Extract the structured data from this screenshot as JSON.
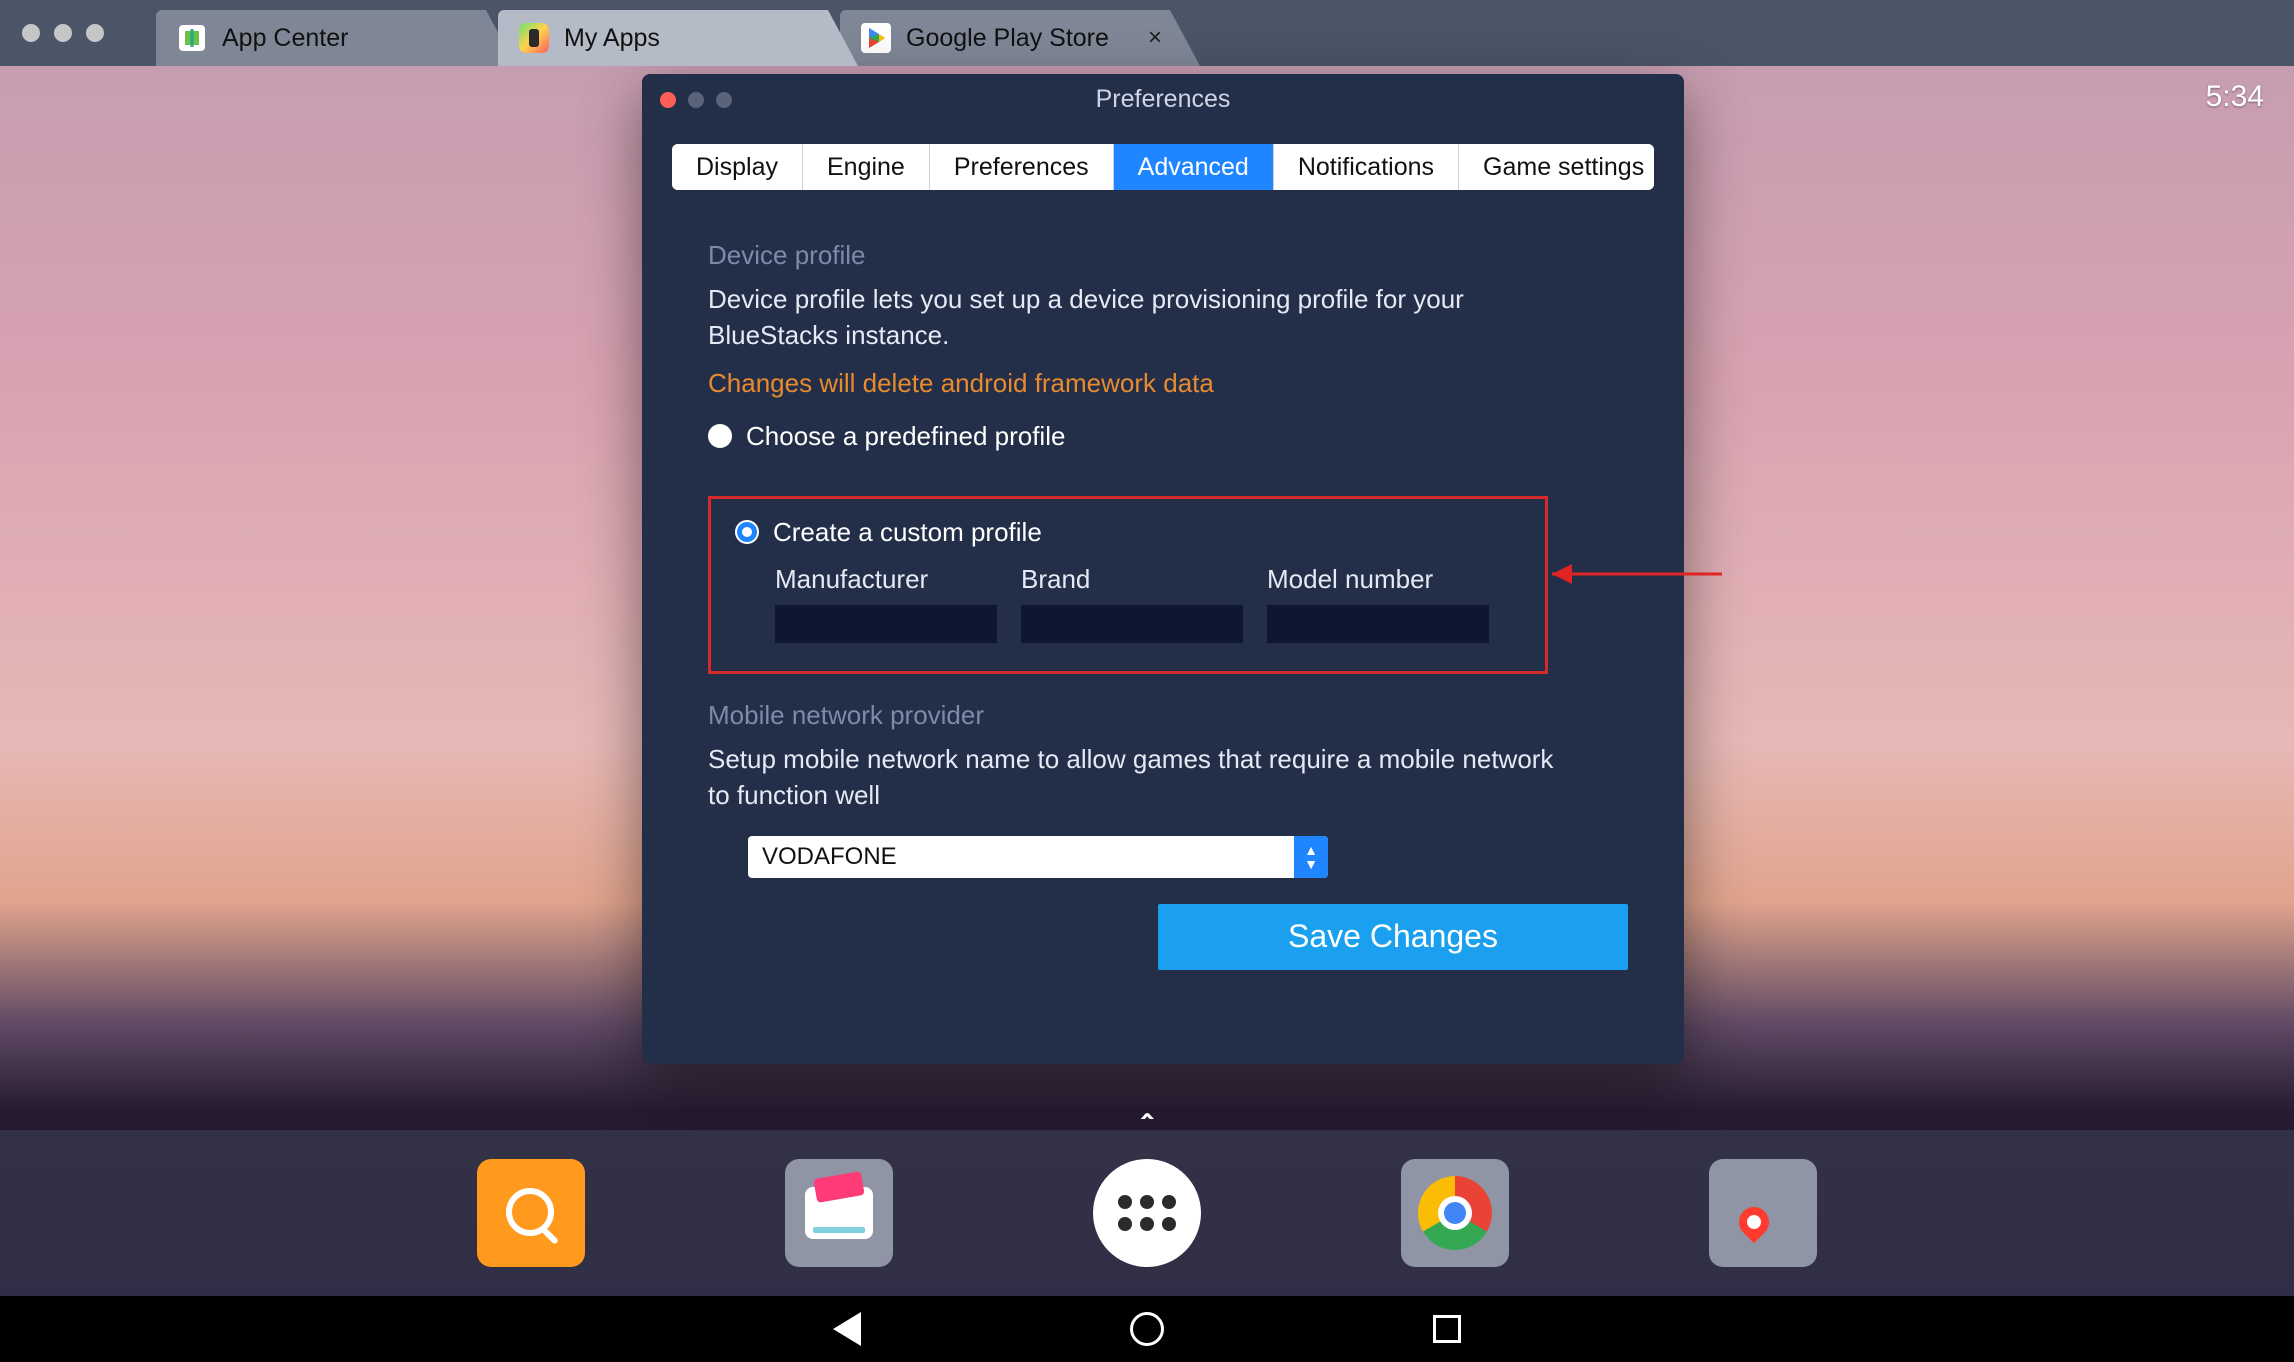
{
  "clock": "5:34",
  "tabs": [
    {
      "label": "App Center",
      "active": false,
      "closable": false
    },
    {
      "label": "My Apps",
      "active": true,
      "closable": false
    },
    {
      "label": "Google Play Store",
      "active": false,
      "closable": true
    }
  ],
  "preferences": {
    "title": "Preferences",
    "tabs": [
      "Display",
      "Engine",
      "Preferences",
      "Advanced",
      "Notifications",
      "Game settings"
    ],
    "active_tab": "Advanced",
    "device_profile": {
      "header": "Device profile",
      "description": "Device profile lets you set up a device provisioning profile for your BlueStacks instance.",
      "warning": "Changes will delete android framework data",
      "predefined_label": "Choose a predefined profile",
      "custom_label": "Create a custom profile",
      "fields": {
        "manufacturer": {
          "label": "Manufacturer",
          "value": ""
        },
        "brand": {
          "label": "Brand",
          "value": ""
        },
        "model": {
          "label": "Model number",
          "value": ""
        }
      }
    },
    "network": {
      "header": "Mobile network provider",
      "description": "Setup mobile network name to allow games that require a mobile network to function well",
      "selected": "VODAFONE"
    },
    "save_label": "Save Changes"
  },
  "dock": {
    "items": [
      "search",
      "wallet",
      "launcher",
      "chrome",
      "maps"
    ]
  }
}
